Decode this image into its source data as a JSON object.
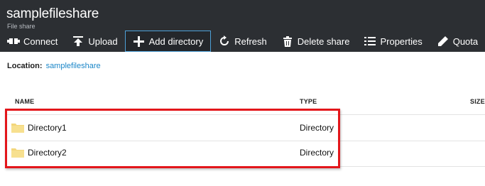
{
  "header": {
    "title": "samplefileshare",
    "subtitle": "File share"
  },
  "toolbar": {
    "connect": "Connect",
    "upload": "Upload",
    "add_directory": "Add directory",
    "refresh": "Refresh",
    "delete_share": "Delete share",
    "properties": "Properties",
    "quota": "Quota"
  },
  "location": {
    "label": "Location:",
    "value": "samplefileshare"
  },
  "table": {
    "columns": [
      "NAME",
      "TYPE",
      "SIZE"
    ],
    "rows": [
      {
        "name": "Directory1",
        "type": "Directory"
      },
      {
        "name": "Directory2",
        "type": "Directory"
      }
    ]
  },
  "colors": {
    "header_bg": "#2c2f33",
    "link": "#1a86c8",
    "highlight": "#e3161b",
    "folder": "#f3d67b"
  },
  "icons": [
    "connect-icon",
    "upload-icon",
    "plus-icon",
    "refresh-icon",
    "trash-icon",
    "list-icon",
    "pencil-icon",
    "folder-icon"
  ]
}
